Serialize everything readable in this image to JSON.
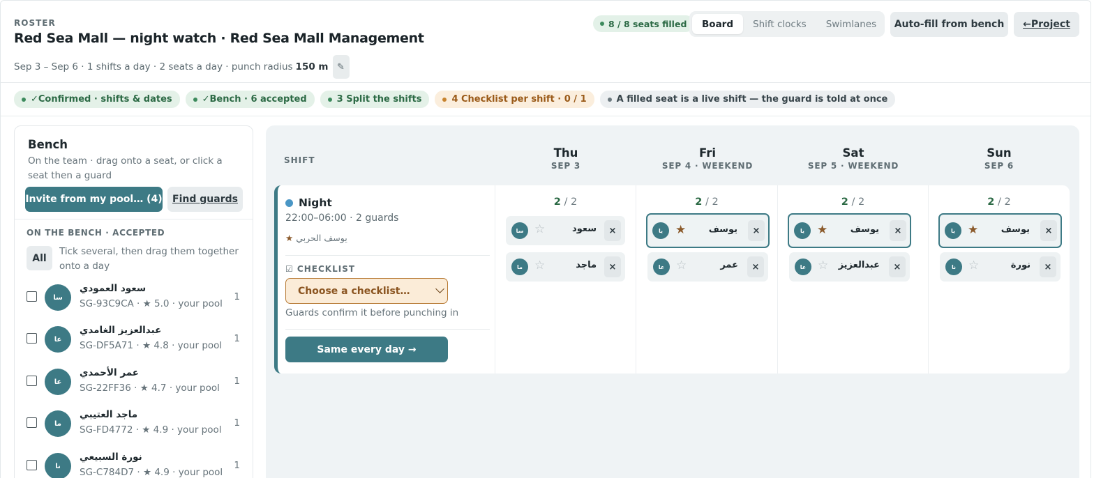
{
  "header": {
    "eyebrow": "ROSTER",
    "title": "Red Sea Mall — night watch · Red Sea Mall Management",
    "subline_text": "Sep 3 – Sep 6 · 1 shifts a day · 2 seats a day · punch radius",
    "punch_radius": "150 m",
    "edit_icon": "pencil-icon",
    "seats_filled": "8 / 8 seats filled",
    "view_tabs": [
      "Board",
      "Shift clocks",
      "Swimlanes"
    ],
    "active_tab": "Board",
    "autofill_label": "Auto-fill from bench",
    "back_label": "←Project"
  },
  "steps": [
    {
      "label": "✓Confirmed · shifts & dates",
      "state": "done"
    },
    {
      "label": "✓Bench · 6 accepted",
      "state": "done"
    },
    {
      "label": "3 Split the shifts",
      "state": "done"
    },
    {
      "label": "4 Checklist per shift · 0 / 1",
      "state": "warn"
    },
    {
      "label": "A filled seat is a live shift — the guard is told at once",
      "state": "info"
    }
  ],
  "bench": {
    "title": "Bench",
    "description": "On the team · drag onto a seat, or click a seat then a guard",
    "invite_label": "Invite from my pool… (4)",
    "find_label": "Find guards",
    "subheading": "ON THE BENCH · ACCEPTED",
    "all_label": "All",
    "tick_hint": "Tick several, then drag them together onto a day",
    "guards": [
      {
        "initials": "سا",
        "name": "سعود العمودي",
        "meta": "SG-93C9CA · ★ 5.0 · your pool",
        "count": "1"
      },
      {
        "initials": "عا",
        "name": "عبدالعزيز الغامدي",
        "meta": "SG-DF5A71 · ★ 4.8 · your pool",
        "count": "1"
      },
      {
        "initials": "عا",
        "name": "عمر الأحمدي",
        "meta": "SG-22FF36 · ★ 4.7 · your pool",
        "count": "1"
      },
      {
        "initials": "ما",
        "name": "ماجد العتيبي",
        "meta": "SG-FD4772 · ★ 4.9 · your pool",
        "count": "1"
      },
      {
        "initials": "نا",
        "name": "نورة السبيعي",
        "meta": "SG-C784D7 · ★ 4.9 · your pool",
        "count": "1"
      }
    ]
  },
  "board": {
    "shift_col_label": "SHIFT",
    "days": [
      {
        "name": "Thu",
        "date": "SEP 3"
      },
      {
        "name": "Fri",
        "date": "SEP 4 · WEEKEND"
      },
      {
        "name": "Sat",
        "date": "SEP 5 · WEEKEND"
      },
      {
        "name": "Sun",
        "date": "SEP 6"
      }
    ],
    "shift": {
      "name": "Night",
      "time": "22:00–06:00 · 2 guards",
      "lead_star": "★",
      "lead_name": "يوسف الحربي",
      "checklist_label": "☑ CHECKLIST",
      "checklist_placeholder": "Choose a checklist…",
      "checklist_hint": "Guards confirm it before punching in",
      "same_every_day_label": "Same every day →",
      "dot_color": "#4a96c5",
      "accent_color": "#3d7a85"
    },
    "cells": [
      {
        "filled": "2",
        "total": "/ 2",
        "seats": [
          {
            "initials": "سا",
            "star": "☆",
            "lead": false,
            "name": "سعود",
            "remove": "×"
          },
          {
            "initials": "ما",
            "star": "☆",
            "lead": false,
            "name": "ماجد",
            "remove": "×"
          }
        ]
      },
      {
        "filled": "2",
        "total": "/ 2",
        "seats": [
          {
            "initials": "يا",
            "star": "★",
            "lead": true,
            "name": "يوسف",
            "remove": "×"
          },
          {
            "initials": "عا",
            "star": "☆",
            "lead": false,
            "name": "عمر",
            "remove": "×"
          }
        ]
      },
      {
        "filled": "2",
        "total": "/ 2",
        "seats": [
          {
            "initials": "يا",
            "star": "★",
            "lead": true,
            "name": "يوسف",
            "remove": "×"
          },
          {
            "initials": "عا",
            "star": "☆",
            "lead": false,
            "name": "عبدالعزيز",
            "remove": "×"
          }
        ]
      },
      {
        "filled": "2",
        "total": "/ 2",
        "seats": [
          {
            "initials": "يا",
            "star": "★",
            "lead": true,
            "name": "يوسف",
            "remove": "×"
          },
          {
            "initials": "نا",
            "star": "☆",
            "lead": false,
            "name": "نورة",
            "remove": "×"
          }
        ]
      }
    ]
  }
}
